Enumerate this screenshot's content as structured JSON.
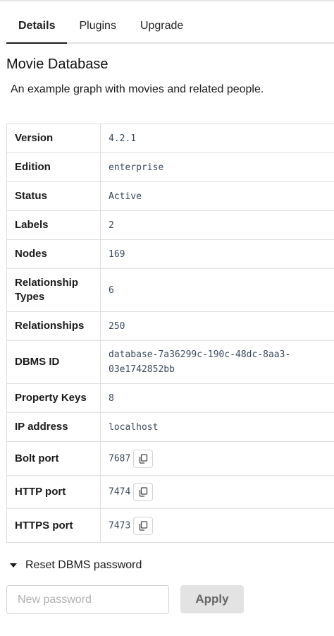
{
  "tabs": [
    {
      "label": "Details",
      "active": true
    },
    {
      "label": "Plugins",
      "active": false
    },
    {
      "label": "Upgrade",
      "active": false
    }
  ],
  "db": {
    "title": "Movie Database",
    "description": "An example graph with movies and related people."
  },
  "details": [
    {
      "key": "Version",
      "value": "4.2.1"
    },
    {
      "key": "Edition",
      "value": "enterprise"
    },
    {
      "key": "Status",
      "value": "Active"
    },
    {
      "key": "Labels",
      "value": "2"
    },
    {
      "key": "Nodes",
      "value": "169"
    },
    {
      "key": "Relationship Types",
      "value": "6"
    },
    {
      "key": "Relationships",
      "value": "250"
    },
    {
      "key": "DBMS ID",
      "value": "database-7a36299c-190c-48dc-8aa3-03e1742852bb"
    },
    {
      "key": "Property Keys",
      "value": "8"
    },
    {
      "key": "IP address",
      "value": "localhost"
    },
    {
      "key": "Bolt port",
      "value": "7687"
    },
    {
      "key": "HTTP port",
      "value": "7474"
    },
    {
      "key": "HTTPS port",
      "value": "7473"
    }
  ],
  "icons": {
    "copy": "copy-icon",
    "caret": "caret-down-icon"
  },
  "reset": {
    "label": "Reset DBMS password",
    "placeholder": "New password",
    "value": "",
    "apply_label": "Apply"
  }
}
